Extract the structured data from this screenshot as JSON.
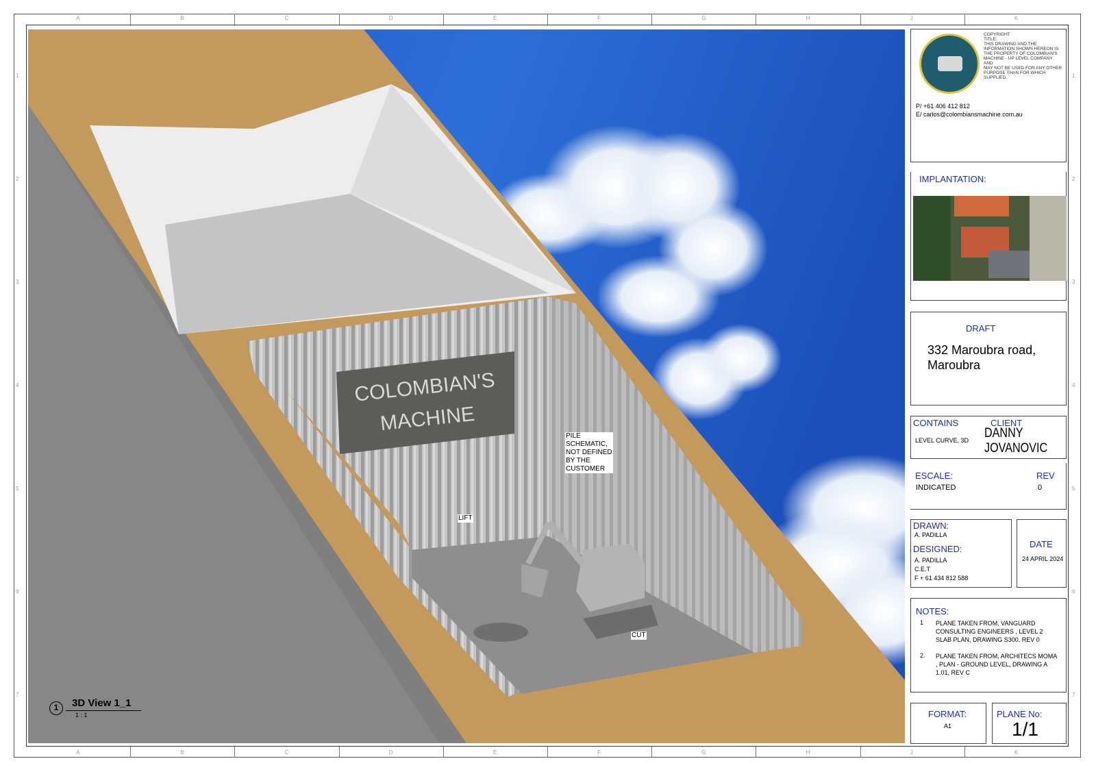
{
  "title_block": {
    "logo_alt": "COLOMBIAN'S MACHINE S.A.S. Construcciones y equipo",
    "copyright_lines": [
      "COPYRIGHT",
      "TITLE:",
      "THIS DRAWING AND THE",
      "INFORMATION SHOWN HEREON IS",
      "THE PROPERTY OF COLOMBIAN'S",
      "MACHINE - UP LEVEL COMPANY",
      "AND",
      "MAY NOT BE USED FOR ANY OTHER",
      "PURPOSE THAN FOR WHICH",
      "SUPPLIED."
    ],
    "phone": "P/ +61 406 412 812",
    "email": "E/ carlos@colombiansmachine.com.au",
    "implantation_label": "IMPLANTATION:",
    "draft_label": "DRAFT",
    "address_line1": "332 Maroubra road,",
    "address_line2": "Maroubra",
    "contains_label": "CONTAINS",
    "contains_value": "LEVEL CURVE, 3D",
    "client_label": "CLIENT",
    "client_name_line1": "DANNY",
    "client_name_line2": "JOVANOVIC",
    "escale_label": "ESCALE:",
    "escale_value": "INDICATED",
    "rev_label": "REV",
    "rev_value": "0",
    "drawn_label": "DRAWN:",
    "drawn_value": "A.    PADILLA",
    "designed_label": "DESIGNED:",
    "designed_value": "A.    PADILLA",
    "designed_extra1": "C.E.T",
    "designed_extra2": "F + 61 434 812 588",
    "date_label": "DATE",
    "date_value": "24 APRIL 2024",
    "notes_label": "NOTES:",
    "notes": [
      {
        "num": "1",
        "text": "PLANE TAKEN FROM, VANGUARD CONSULTING ENGINEERS , LEVEL 2 SLAB PLAN, DRAWING S300, REV 0"
      },
      {
        "num": "2.",
        "text": "PLANE TAKEN FROM, ARCHITECS MOMA , PLAN - GROUND LEVEL, DRAWING A 1.01, REV C"
      }
    ],
    "format_label": "FORMAT:",
    "format_value": "A1",
    "plane_label": "PLANE No:",
    "plane_value": "1/1"
  },
  "view": {
    "sign_line1": "COLOMBIAN'S",
    "sign_line2": "MACHINE",
    "pile_callout": [
      "PILE",
      "SCHEMATIC,",
      "NOT DEFINED",
      "BY THE",
      "CUSTOMER"
    ],
    "lift_label": "LIFT",
    "cut_label": "CUT",
    "view_number": "1",
    "view_title": "3D View 1_1",
    "view_scale": "1 : 1"
  },
  "grid": {
    "cols": [
      "A",
      "B",
      "C",
      "D",
      "E",
      "F",
      "G",
      "H",
      "J",
      "K"
    ],
    "rows": [
      "1",
      "2",
      "3",
      "4",
      "5",
      "6",
      "7"
    ]
  }
}
